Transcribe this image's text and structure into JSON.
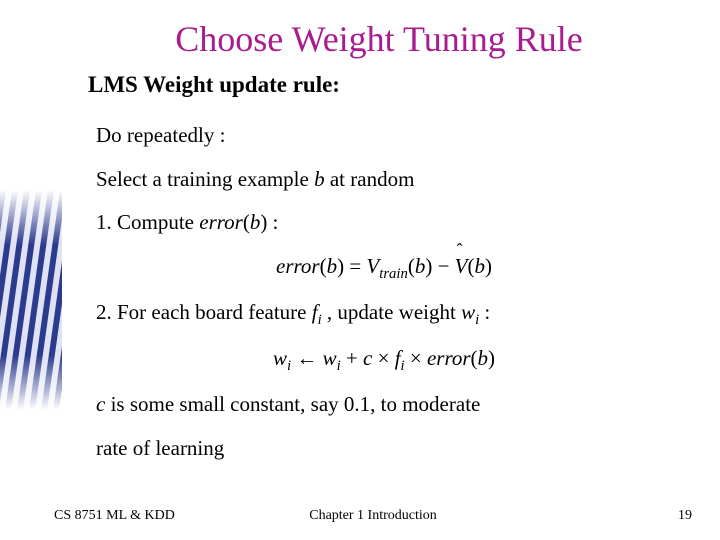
{
  "title": "Choose Weight Tuning Rule",
  "subtitle": "LMS Weight update rule:",
  "body": {
    "repeat": "Do repeatedly :",
    "select_pre": "Select a training example ",
    "select_var": "b",
    "select_post": " at random",
    "step1_pre": "1. Compute ",
    "step1_err": "error",
    "step1_b": "b",
    "eq1_error": "error",
    "eq1_b1": "b",
    "eq1_eq": " = ",
    "eq1_V": "V",
    "eq1_train": "train",
    "eq1_b2": "b",
    "eq1_minus": " − ",
    "eq1_Vhat": "V",
    "eq1_b3": "b",
    "step2_pre": "2. For each board feature ",
    "step2_f": "f",
    "step2_i1": "i",
    "step2_mid": " , update weight ",
    "step2_w": "w",
    "step2_i2": "i",
    "step2_colon": " :",
    "eq2_w1": "w",
    "eq2_i1": "i",
    "eq2_arrow": " ← ",
    "eq2_w2": "w",
    "eq2_i2": "i",
    "eq2_plus": " + ",
    "eq2_c": "c",
    "eq2_times1": " × ",
    "eq2_f": "f",
    "eq2_i3": "i",
    "eq2_times2": " × ",
    "eq2_error": "error",
    "eq2_b": "b",
    "note_c": "c",
    "note_line1": " is some small constant, say 0.1, to moderate",
    "note_line2": "rate of learning"
  },
  "footer": {
    "left": "CS 8751 ML & KDD",
    "center": "Chapter 1  Introduction",
    "right": "19"
  }
}
